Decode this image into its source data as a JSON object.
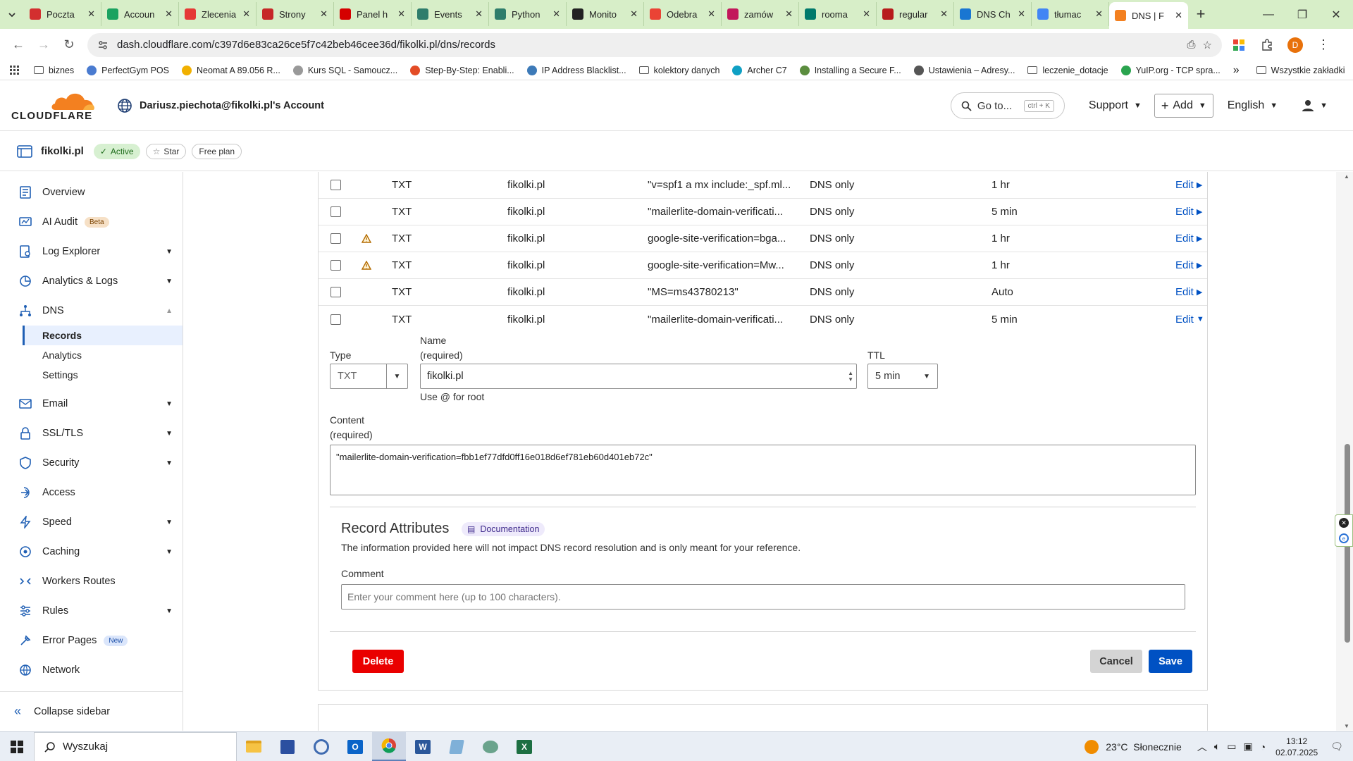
{
  "browser": {
    "tabs": [
      {
        "label": "Poczta",
        "color": "#d32f2f"
      },
      {
        "label": "Accoun",
        "color": "#1aa260"
      },
      {
        "label": "Zlecenia",
        "color": "#e53935"
      },
      {
        "label": "Strony",
        "color": "#c62828"
      },
      {
        "label": "Panel h",
        "color": "#d50000"
      },
      {
        "label": "Events",
        "color": "#2e7d6b"
      },
      {
        "label": "Python",
        "color": "#2e7d6b"
      },
      {
        "label": "Monito",
        "color": "#222222"
      },
      {
        "label": "Odebra",
        "color": "#ea4335"
      },
      {
        "label": "zamów",
        "color": "#c2185b"
      },
      {
        "label": "rooma",
        "color": "#00796b"
      },
      {
        "label": "regular",
        "color": "#b71c1c"
      },
      {
        "label": "DNS Ch",
        "color": "#1976d2"
      },
      {
        "label": "tłumac",
        "color": "#4285f4"
      },
      {
        "label": "DNS | F",
        "color": "#f38020"
      }
    ],
    "url": "dash.cloudflare.com/c397d6e83ca26ce5f7c42beb46cee36d/fikolki.pl/dns/records",
    "bookmarks": [
      "biznes",
      "PerfectGym POS",
      "Neomat A 89.056 R...",
      "Kurs SQL - Samoucz...",
      "Step-By-Step: Enabli...",
      "IP Address Blacklist...",
      "kolektory danych",
      "Archer C7",
      "Installing a Secure F...",
      "Ustawienia – Adresy...",
      "leczenie_dotacje",
      "YuIP.org - TCP spra..."
    ],
    "bookmarks_more": "»",
    "all_bookmarks": "Wszystkie zakładki",
    "profile_initial": "D"
  },
  "header": {
    "logo_text": "CLOUDFLARE",
    "account": "Dariusz.piechota@fikolki.pl's Account",
    "goto_label": "Go to...",
    "goto_shortcut": "ctrl + K",
    "support": "Support",
    "add": "Add",
    "language": "English"
  },
  "zone": {
    "name": "fikolki.pl",
    "status": "Active",
    "star": "Star",
    "plan": "Free plan"
  },
  "sidebar": {
    "items": [
      {
        "label": "Overview"
      },
      {
        "label": "AI Audit",
        "badge": "Beta"
      },
      {
        "label": "Log Explorer"
      },
      {
        "label": "Analytics & Logs"
      },
      {
        "label": "DNS"
      },
      {
        "label": "Email"
      },
      {
        "label": "SSL/TLS"
      },
      {
        "label": "Security"
      },
      {
        "label": "Access"
      },
      {
        "label": "Speed"
      },
      {
        "label": "Caching"
      },
      {
        "label": "Workers Routes"
      },
      {
        "label": "Rules"
      },
      {
        "label": "Error Pages",
        "badge": "New"
      },
      {
        "label": "Network"
      }
    ],
    "dns_sub": [
      "Records",
      "Analytics",
      "Settings"
    ],
    "collapse": "Collapse sidebar"
  },
  "records": [
    {
      "type": "TXT",
      "name": "fikolki.pl",
      "content": "\"v=spf1 a mx include:_spf.ml...",
      "proxy": "DNS only",
      "ttl": "1 hr",
      "action": "Edit",
      "warn": false
    },
    {
      "type": "TXT",
      "name": "fikolki.pl",
      "content": "\"mailerlite-domain-verificati...",
      "proxy": "DNS only",
      "ttl": "5 min",
      "action": "Edit",
      "warn": false
    },
    {
      "type": "TXT",
      "name": "fikolki.pl",
      "content": "google-site-verification=bga...",
      "proxy": "DNS only",
      "ttl": "1 hr",
      "action": "Edit",
      "warn": true
    },
    {
      "type": "TXT",
      "name": "fikolki.pl",
      "content": "google-site-verification=Mw...",
      "proxy": "DNS only",
      "ttl": "1 hr",
      "action": "Edit",
      "warn": true
    },
    {
      "type": "TXT",
      "name": "fikolki.pl",
      "content": "\"MS=ms43780213\"",
      "proxy": "DNS only",
      "ttl": "Auto",
      "action": "Edit",
      "warn": false
    },
    {
      "type": "TXT",
      "name": "fikolki.pl",
      "content": "\"mailerlite-domain-verificati...",
      "proxy": "DNS only",
      "ttl": "5 min",
      "action": "Edit",
      "warn": false
    }
  ],
  "form": {
    "type_label": "Type",
    "type_value": "TXT",
    "name_label": "Name",
    "name_required": "(required)",
    "name_value": "fikolki.pl",
    "name_hint": "Use @ for root",
    "ttl_label": "TTL",
    "ttl_value": "5 min",
    "content_label": "Content",
    "content_required": "(required)",
    "content_value": "\"mailerlite-domain-verification=fbb1ef77dfd0ff16e018d6ef781eb60d401eb72c\"",
    "attr_title": "Record Attributes",
    "doc_label": "Documentation",
    "attr_desc": "The information provided here will not impact DNS record resolution and is only meant for your reference.",
    "comment_label": "Comment",
    "comment_placeholder": "Enter your comment here (up to 100 characters).",
    "delete": "Delete",
    "cancel": "Cancel",
    "save": "Save"
  },
  "taskbar": {
    "search": "Wyszukaj",
    "weather": "23°C  Słonecznie",
    "time": "13:12",
    "date": "02.07.2025"
  },
  "colors": {
    "accent": "#f38020",
    "link": "#0051c3",
    "save": "#0051c3",
    "delete": "#ea0000",
    "tabbar": "#d7eec8"
  }
}
